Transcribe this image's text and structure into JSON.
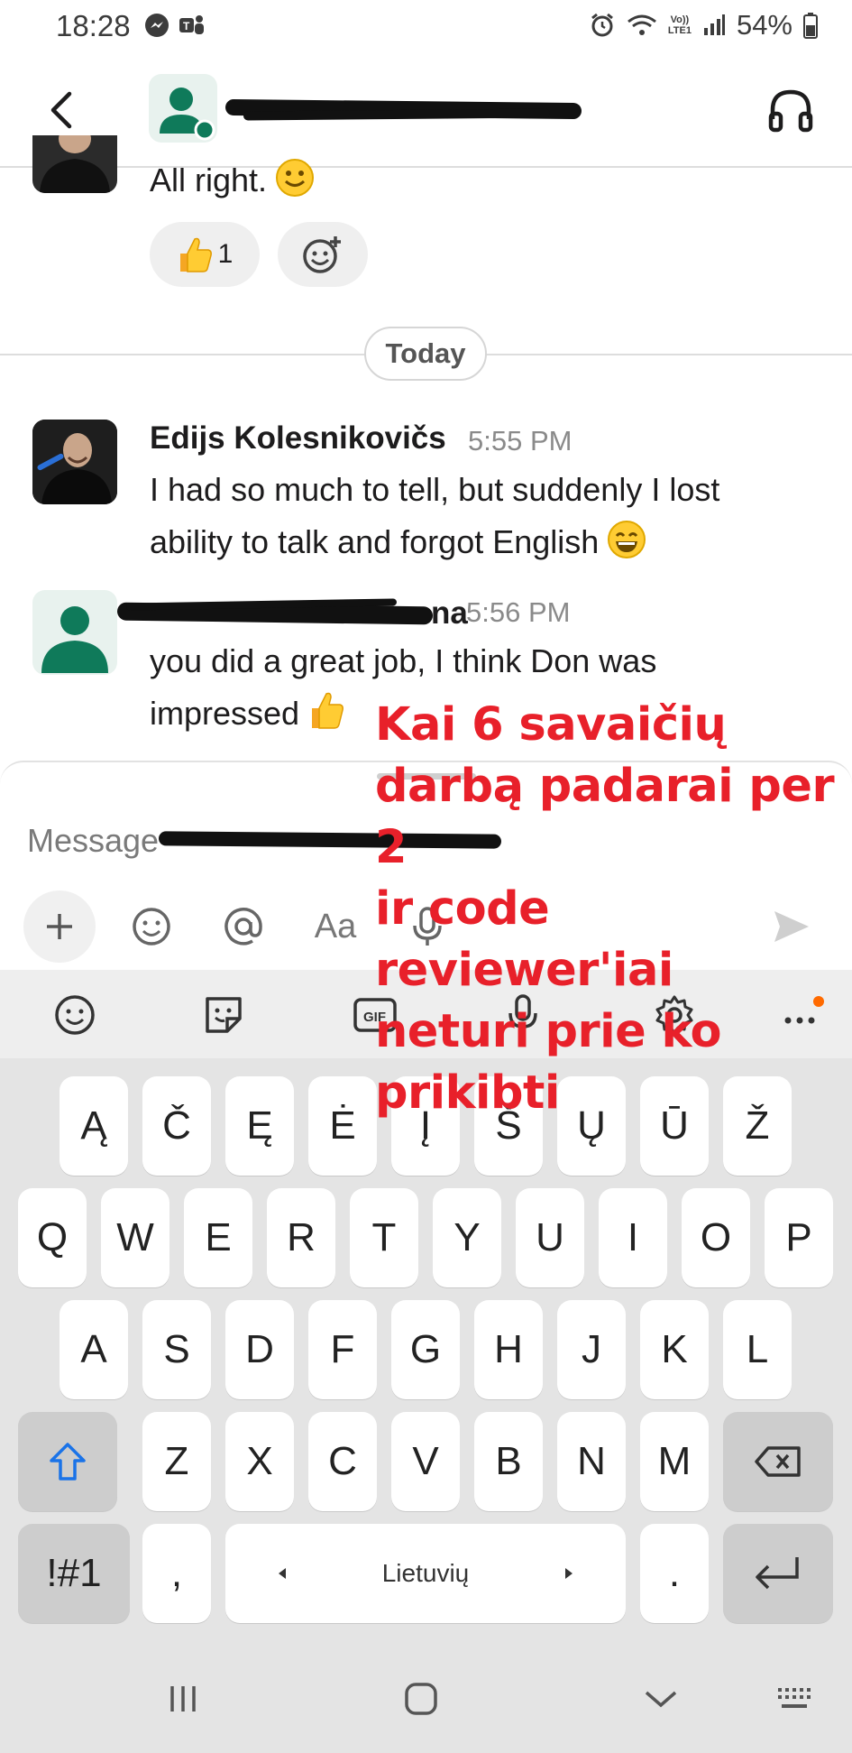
{
  "status_bar": {
    "time": "18:28",
    "network_top": "Vo))",
    "network_bottom": "LTE1",
    "battery": "54%"
  },
  "header": {
    "icons": [
      "back-icon",
      "headphones-icon"
    ]
  },
  "messages": {
    "previous_text": "All right.",
    "reaction_thumbs_count": "1",
    "day_divider": "Today",
    "msg1": {
      "author": "Edijs Kolesnikovičs",
      "time": "5:55 PM",
      "line1": "I had so much to tell, but suddenly I lost",
      "line2": "ability to talk and forgot English"
    },
    "msg2": {
      "author_suffix": "na",
      "time": "5:56 PM",
      "line1": "you did a great job, I think Don was",
      "line2": "impressed"
    }
  },
  "composer": {
    "placeholder_prefix": "Message",
    "format_label": "Aa"
  },
  "keyboard": {
    "row0": [
      "Ą",
      "Č",
      "Ę",
      "Ė",
      "Į",
      "Š",
      "Ų",
      "Ū",
      "Ž"
    ],
    "row1": [
      "Q",
      "W",
      "E",
      "R",
      "T",
      "Y",
      "U",
      "I",
      "O",
      "P"
    ],
    "row2": [
      "A",
      "S",
      "D",
      "F",
      "G",
      "H",
      "J",
      "K",
      "L"
    ],
    "row3": [
      "Z",
      "X",
      "C",
      "V",
      "B",
      "N",
      "M"
    ],
    "symbols": "!#1",
    "comma": ",",
    "space": "Lietuvių",
    "period": ".",
    "gif_label": "GIF"
  },
  "caption": {
    "line1": "Kai 6 savaičių",
    "line2": "darbą padarai per 2",
    "line3": "ir code reviewer'iai",
    "line4": "neturi prie ko",
    "line5": "prikibti"
  },
  "colors": {
    "accent_green": "#0f7a5a",
    "caption_red": "#e8202a",
    "keyboard_bg": "#e4e4e4"
  }
}
